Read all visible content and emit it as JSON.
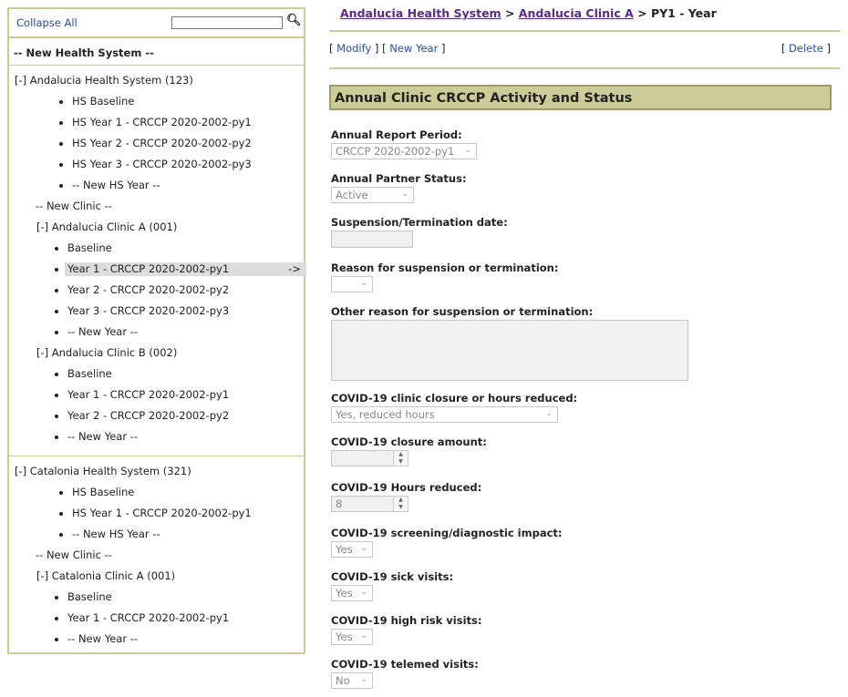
{
  "sidebar": {
    "collapse_all": "Collapse All",
    "search_placeholder": "",
    "new_health_system": "-- New Health System --",
    "systems": [
      {
        "label": "[-] Andalucia Health System (123)",
        "hs_items": [
          "HS Baseline",
          "HS Year 1 - CRCCP 2020-2002-py1",
          "HS Year 2 - CRCCP 2020-2002-py2",
          "HS Year 3 - CRCCP 2020-2002-py3",
          "-- New HS Year --"
        ],
        "new_clinic": "-- New Clinic --",
        "clinics": [
          {
            "label": "[-] Andalucia Clinic A (001)",
            "items": [
              "Baseline",
              "Year 1 - CRCCP 2020-2002-py1",
              "Year 2 - CRCCP 2020-2002-py2",
              "Year 3 - CRCCP 2020-2002-py3",
              "-- New Year --"
            ]
          },
          {
            "label": "[-] Andalucia Clinic B (002)",
            "items": [
              "Baseline",
              "Year 1 - CRCCP 2020-2002-py1",
              "Year 2 - CRCCP 2020-2002-py2",
              "-- New Year --"
            ]
          }
        ]
      },
      {
        "label": "[-] Catalonia Health System (321)",
        "hs_items": [
          "HS Baseline",
          "HS Year 1 - CRCCP 2020-2002-py1",
          "-- New HS Year --"
        ],
        "new_clinic": "-- New Clinic --",
        "clinics": [
          {
            "label": "[-] Catalonia Clinic A (001)",
            "items": [
              "Baseline",
              "Year 1 - CRCCP 2020-2002-py1",
              "-- New Year --"
            ]
          }
        ]
      }
    ],
    "selected_arrow": "->"
  },
  "breadcrumb": {
    "items": [
      "Andalucia Health System",
      "Andalucia Clinic A"
    ],
    "sep": ">",
    "current": "PY1 - Year"
  },
  "actions": {
    "modify": "Modify",
    "new_year": "New Year",
    "delete": "Delete"
  },
  "section_title": "Annual Clinic CRCCP Activity and Status",
  "fields": [
    {
      "label": "Annual Report Period:",
      "value": "CRCCP 2020-2002-py1"
    },
    {
      "label": "Annual Partner Status:",
      "value": "Active"
    },
    {
      "label": "Suspension/Termination date:",
      "value": ""
    },
    {
      "label": "Reason for suspension or termination:",
      "value": ""
    },
    {
      "label": "Other reason for suspension or termination:",
      "value": ""
    },
    {
      "label": "COVID-19 clinic closure or hours reduced:",
      "value": "Yes, reduced hours"
    },
    {
      "label": "COVID-19 closure amount:",
      "value": ""
    },
    {
      "label": "COVID-19 Hours reduced:",
      "value": "8"
    },
    {
      "label": "COVID-19 screening/diagnostic impact:",
      "value": "Yes"
    },
    {
      "label": "COVID-19 sick visits:",
      "value": "Yes"
    },
    {
      "label": "COVID-19 high risk visits:",
      "value": "Yes"
    },
    {
      "label": "COVID-19 telemed visits:",
      "value": "No"
    }
  ],
  "colors": {
    "panel_border": "#cfc89a",
    "section_bg": "#cccc99",
    "link": "#2a4fa0",
    "breadcrumb_link": "#5b2a86"
  }
}
